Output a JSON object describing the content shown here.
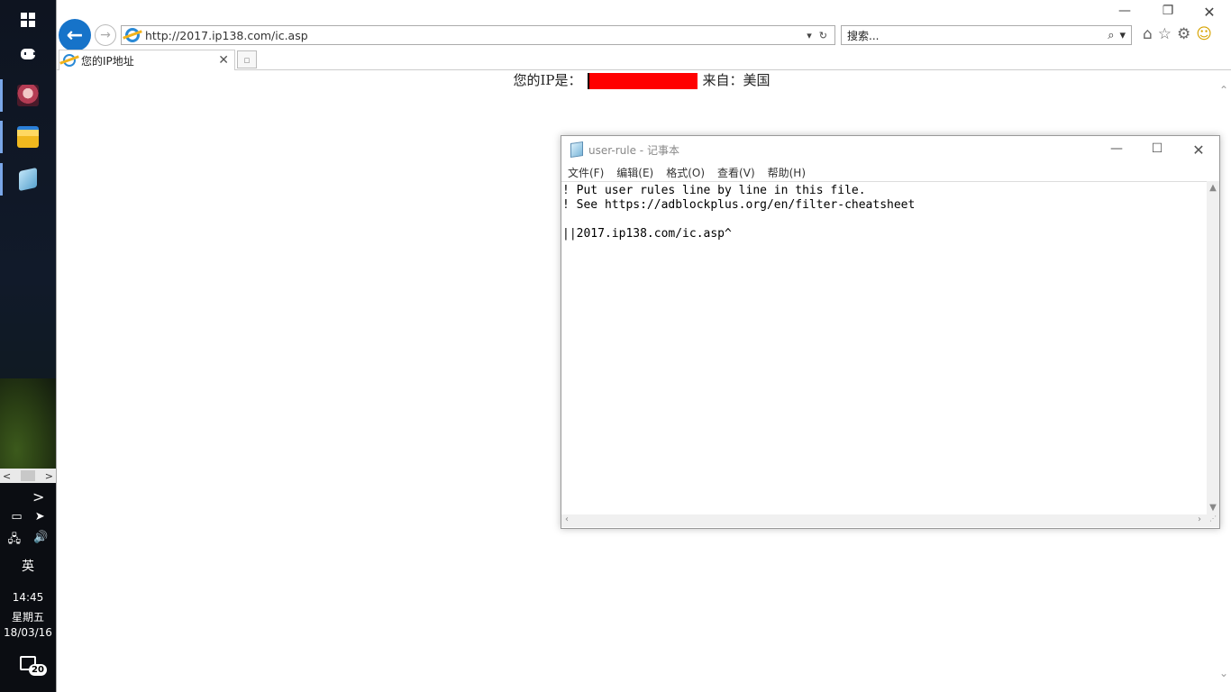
{
  "taskbar": {
    "scroll_left": "<",
    "scroll_right": ">",
    "tray_expand": ">",
    "ime": "英",
    "time": "14:45",
    "day": "星期五",
    "date": "18/03/16",
    "notification_count": "20"
  },
  "browser": {
    "url": "http://2017.ip138.com/ic.asp",
    "search_placeholder": "搜索...",
    "tab_title": "您的IP地址",
    "window": {
      "minimize": "—",
      "restore": "❐",
      "close": "✕"
    }
  },
  "page": {
    "ip_label": "您的IP是：",
    "from_text": "来自：美国",
    "redaction_color": "#ff0000"
  },
  "notepad": {
    "title": "user-rule - 记事本",
    "menu": [
      "文件(F)",
      "编辑(E)",
      "格式(O)",
      "查看(V)",
      "帮助(H)"
    ],
    "content": "! Put user rules line by line in this file.\n! See https://adblockplus.org/en/filter-cheatsheet\n\n||2017.ip138.com/ic.asp^"
  },
  "colors": {
    "accent_blue": "#1673c9",
    "taskbar_bg": "#111a2a"
  }
}
